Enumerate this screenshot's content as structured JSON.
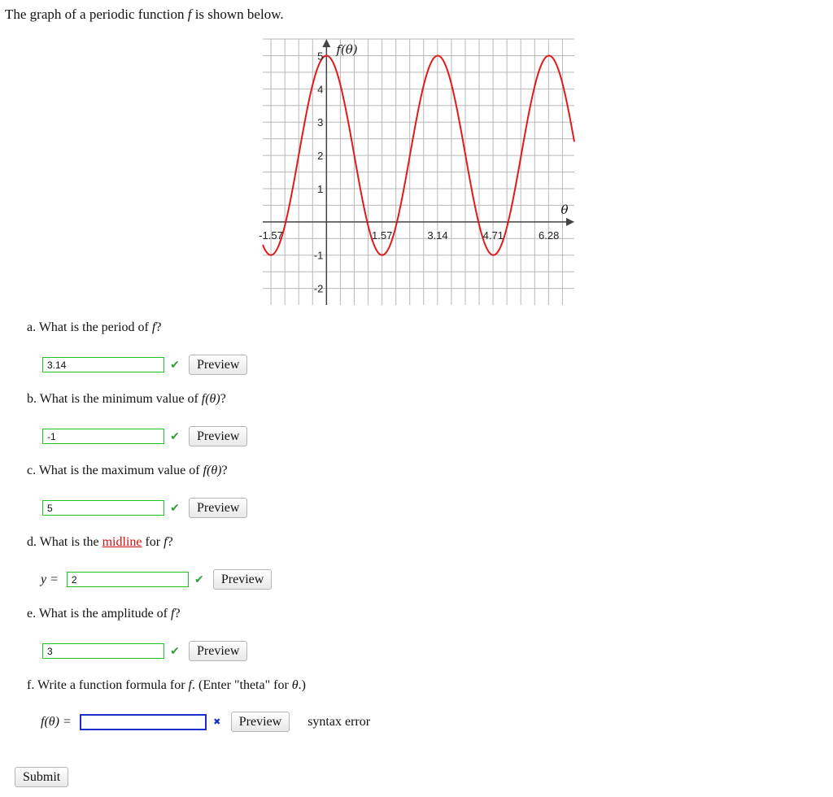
{
  "intro": {
    "pre": "The graph of a periodic function ",
    "fn": "f",
    "post": " is shown below."
  },
  "colors": {
    "curve": "#e01b1b",
    "grid": "#b8b8b8",
    "ok_border": "#22c222",
    "check": "#29a33a",
    "error_border": "#1a2ec8"
  },
  "chart_data": {
    "type": "line",
    "title": "",
    "xlabel": "θ",
    "ylabel": "f(θ)",
    "xlim": [
      -1.8,
      7.0
    ],
    "ylim": [
      -2.5,
      5.5
    ],
    "grid": true,
    "x_ticks": [
      {
        "value": -1.57,
        "label": "-1.57"
      },
      {
        "value": 1.57,
        "label": "1.57"
      },
      {
        "value": 3.14,
        "label": "3.14"
      },
      {
        "value": 4.71,
        "label": "4.71"
      },
      {
        "value": 6.28,
        "label": "6.28"
      }
    ],
    "y_ticks": [
      {
        "value": -2,
        "label": "-2"
      },
      {
        "value": -1,
        "label": "-1"
      },
      {
        "value": 1,
        "label": "1"
      },
      {
        "value": 2,
        "label": "2"
      },
      {
        "value": 3,
        "label": "3"
      },
      {
        "value": 4,
        "label": "4"
      },
      {
        "value": 5,
        "label": "5"
      }
    ],
    "series": [
      {
        "formula": "2 + 3cos(2θ)",
        "x": [
          -1.8,
          -1.57,
          0,
          1.57,
          3.14,
          4.71,
          6.28,
          7.0
        ],
        "y": [
          -0.67,
          -1,
          5,
          -1,
          5,
          -1,
          5,
          2.0
        ]
      }
    ]
  },
  "questions": {
    "a": {
      "pre": "a. What is the period of ",
      "fn": "f",
      "post": "?",
      "value": "3.14",
      "preview": "Preview"
    },
    "b": {
      "pre": "b. What is the minimum value of ",
      "fn": "f(θ)",
      "post": "?",
      "value": "-1",
      "preview": "Preview"
    },
    "c": {
      "pre": "c. What is the maximum value of ",
      "fn": "f(θ)",
      "post": "?",
      "value": "5",
      "preview": "Preview"
    },
    "d": {
      "pre": "d. What is the ",
      "link": "midline",
      "mid": " for ",
      "fn": "f",
      "post": "?",
      "prefix": "y =",
      "value": "2",
      "preview": "Preview"
    },
    "e": {
      "pre": "e. What is the amplitude of ",
      "fn": "f",
      "post": "?",
      "value": "3",
      "preview": "Preview"
    },
    "f": {
      "pre": "f. Write a function formula for ",
      "fn": "f",
      "mid": ". (Enter \"theta\" for ",
      "theta": "θ",
      "post": ".)",
      "prefix": "f(θ) =",
      "value": "",
      "preview": "Preview",
      "error": "syntax error"
    }
  },
  "submit": "Submit"
}
